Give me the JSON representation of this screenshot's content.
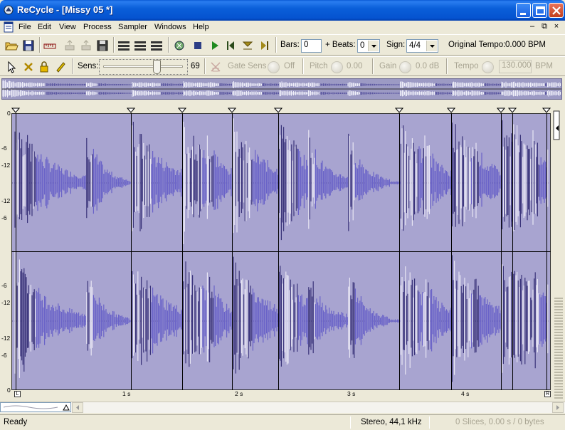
{
  "window": {
    "title": "ReCycle - [Missy 05 *]"
  },
  "menu": {
    "items": [
      "File",
      "Edit",
      "View",
      "Process",
      "Sampler",
      "Windows",
      "Help"
    ]
  },
  "toolbar1": {
    "bars_label": "Bars:",
    "bars_value": "0",
    "beats_label": "+ Beats:",
    "beats_value": "0",
    "sign_label": "Sign:",
    "sign_value": "4/4",
    "original_tempo_label": "Original Tempo:",
    "original_tempo_value": "0.000 BPM"
  },
  "toolbar2": {
    "sens_label": "Sens:",
    "sens_value": "69",
    "gate_sens_label": "Gate Sens",
    "gate_sens_value": "Off",
    "pitch_label": "Pitch",
    "pitch_value": "0.00",
    "gain_label": "Gain",
    "gain_value": "0.0 dB",
    "tempo_label": "Tempo",
    "tempo_value": "130.000",
    "tempo_unit": "BPM"
  },
  "db_scale": {
    "top_channel": [
      "0",
      "-6",
      "-12",
      "-12",
      "-6"
    ],
    "bottom_channel": [
      "-6",
      "-12",
      "-12",
      "-6",
      "0"
    ]
  },
  "time_ruler": {
    "labels": [
      "1 s",
      "2 s",
      "3 s",
      "4 s"
    ],
    "start_marker": "L",
    "end_marker": "R"
  },
  "status": {
    "ready": "Ready",
    "format": "Stereo, 44,1 kHz",
    "slices": "0 Slices, 0.00 s / 0 bytes"
  },
  "colors": {
    "waveform_bg": "#a8a4d0",
    "waveform_fill": "#6a63c8",
    "waveform_hi": "#e8e6f4",
    "title_bar": "#0a5fd9"
  }
}
